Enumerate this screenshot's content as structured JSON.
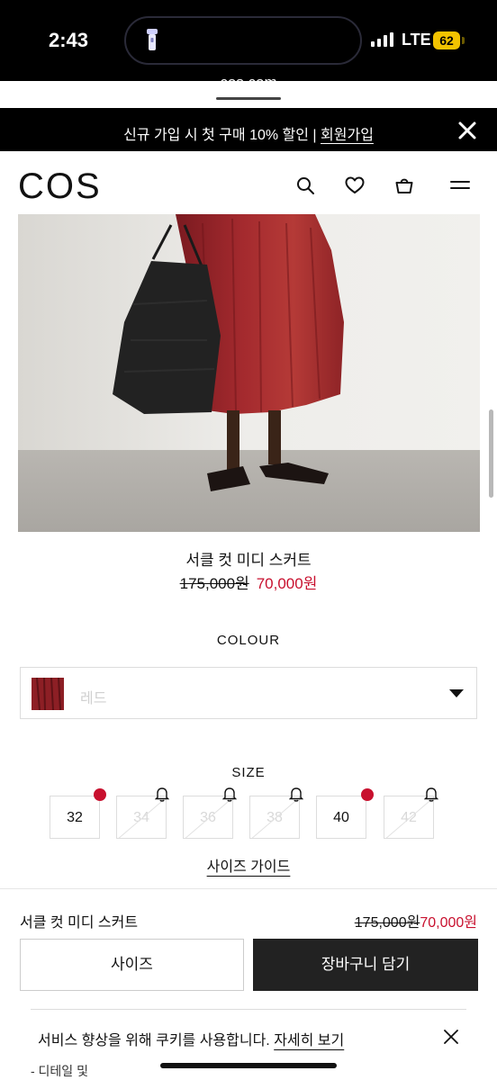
{
  "status_bar": {
    "time": "2:43",
    "network": "LTE",
    "battery": "62"
  },
  "browser": {
    "url": "cos.com"
  },
  "promo": {
    "text": "신규 가입 시 첫 구매 10% 할인 | ",
    "link": "회원가입"
  },
  "header": {
    "logo": "COS"
  },
  "product": {
    "name": "서클 컷 미디 스커트",
    "original_price": "175,000원",
    "sale_price": "70,000원",
    "sale_color": "#c8102e"
  },
  "colour": {
    "label": "COLOUR",
    "value": "레드",
    "swatch_color": "#8d1f25"
  },
  "size": {
    "label": "SIZE",
    "options": [
      {
        "label": "32",
        "available": true
      },
      {
        "label": "34",
        "available": false
      },
      {
        "label": "36",
        "available": false
      },
      {
        "label": "38",
        "available": false
      },
      {
        "label": "40",
        "available": true
      },
      {
        "label": "42",
        "available": false
      }
    ],
    "guide_label": "사이즈 가이드"
  },
  "bottom_bar": {
    "name": "서클 컷 미디 스커트",
    "original_price": "175,000원",
    "sale_price": "70,000원",
    "size_button": "사이즈",
    "cart_button": "장바구니 담기"
  },
  "cookie": {
    "text": "서비스 향상을 위해 쿠키를 사용합니다. ",
    "link": "자세히 보기"
  },
  "peek_text": "- 디테일 및"
}
